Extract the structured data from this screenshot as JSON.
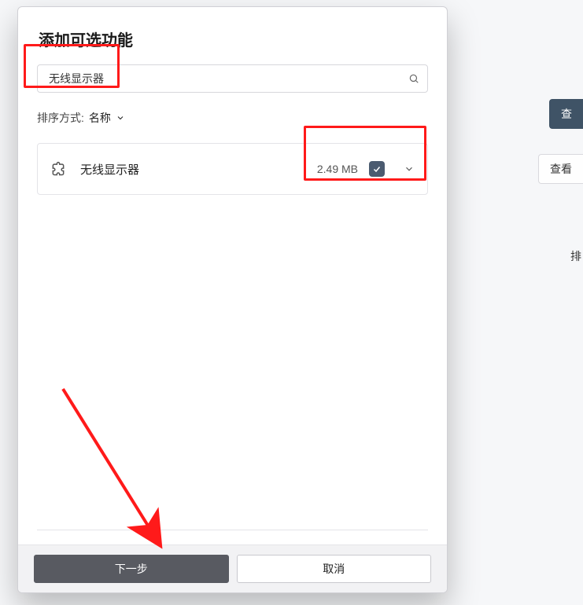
{
  "dialog": {
    "title": "添加可选功能",
    "search": {
      "value": "无线显示器",
      "placeholder": ""
    },
    "sort": {
      "label": "排序方式:",
      "value": "名称"
    },
    "features": [
      {
        "icon": "puzzle-icon",
        "name": "无线显示器",
        "size": "2.49 MB",
        "checked": true
      }
    ],
    "buttons": {
      "next": "下一步",
      "cancel": "取消"
    }
  },
  "background": {
    "primary_button": "查",
    "secondary_button": "查看",
    "sort_hint": "排"
  }
}
